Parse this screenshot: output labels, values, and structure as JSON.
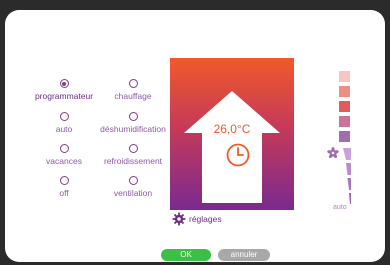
{
  "modes_left": [
    {
      "label": "programmateur",
      "checked": true
    },
    {
      "label": "auto",
      "checked": false
    },
    {
      "label": "vacances",
      "checked": false
    },
    {
      "label": "off",
      "checked": false
    }
  ],
  "modes_right": [
    {
      "label": "chauffage",
      "checked": false
    },
    {
      "label": "déshumidification",
      "checked": false
    },
    {
      "label": "refroidissement",
      "checked": false
    },
    {
      "label": "ventilation",
      "checked": false
    }
  ],
  "thermostat": {
    "temperature": "26,0°C",
    "icon": "clock-icon",
    "gradient_top": "#f05a2a",
    "gradient_bottom": "#7a2a90"
  },
  "settings": {
    "label": "réglages",
    "icon": "gear-icon"
  },
  "temperature_scale": {
    "colors": [
      "#f5c6c2",
      "#ef8e86",
      "#e25a5a",
      "#c9739a",
      "#a26cb0"
    ],
    "selected": 2
  },
  "fan": {
    "icon": "fan-icon",
    "label": "auto"
  },
  "buttons": {
    "ok": "OK",
    "cancel": "annuler"
  },
  "colors": {
    "accent": "#7a3e8e",
    "ok": "#3cbf45",
    "cancel": "#a8a8a8"
  }
}
